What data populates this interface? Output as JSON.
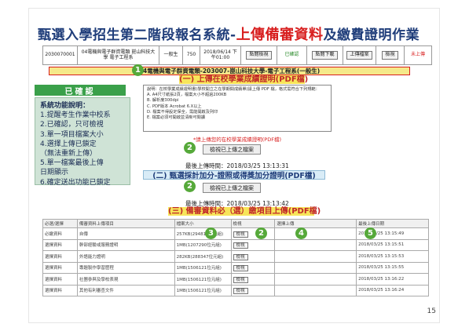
{
  "title": {
    "prefix": "甄選入學招生第二階段報名系統-",
    "highlight": "上傳備審資料",
    "suffix": "及繳費證明作業"
  },
  "record_row": {
    "code": "2030070001",
    "school": "04電機與電子群資電類 崑山科技大學 電子工程系",
    "group": "一般生",
    "fee": "750",
    "date": "2018/06/14 下午01:00",
    "btn1": "點閱檢視",
    "status": "已確認",
    "btn2": "點閱下載",
    "btn3": "上傳檔案",
    "btn4": "檢視",
    "unpaid": "未上傳"
  },
  "bubbles": [
    "1",
    "2",
    "2",
    "3",
    "2",
    "4",
    "5"
  ],
  "dept_bar": "04電機與電子群資電類-203007-崑山科技大學-電子工程系(一般生)",
  "section1": "(一) 上傳在校學業成績證明(PDF檔)",
  "confirmed_label": "已確認",
  "features": {
    "title": "系統功能說明：",
    "items": [
      "1.提醒考生作業中校系",
      "2.已確認，只可檢視",
      "3.單一項目檔案大小",
      "4.選擇上傳已鎖定",
      "（無法重新上傳）",
      "5.單一檔案最後上傳",
      "  日期顯示",
      "6.確定送出功能已鎖定"
    ]
  },
  "desc": {
    "lines": [
      "說明：在校學業成績證明書(學校開立之在學期間成績單)請上傳 PDF 檔，格式需符合下列規範：",
      "A. A4尺寸紙張2頁，檔案大小不超過200KB",
      "B. 解析度300dpi",
      "C. PDF版本 Acrobat 6.X以上",
      "D. 檔案不得設定保全，需能開啟及列印",
      "E. 檔案必須可開啟並清晰可閱讀"
    ]
  },
  "note_red": "*請上傳您的在校學業成績證明(PDF檔)",
  "upload_btn": "檢視已上傳之檔案",
  "time1": "最後上傳時間：2018/03/25 13:13:31",
  "section2": "(二) 甄選採計加分-證照或得獎加分證明(PDF檔)",
  "time2": "最後上傳時間：2018/03/25 13:13:42",
  "section3": "(三) 備審資料必（選）繳項目上傳(PDF檔)",
  "table": {
    "headers": [
      "必選/選擇",
      "備審資料上傳項目",
      "檔案大小",
      "檢視",
      "選擇上傳",
      "最後上傳日期"
    ],
    "rows": [
      [
        "必繳資料",
        "自傳",
        "257KB(294818位元組)",
        "檢視",
        "",
        "2018/03/25 13:15:49"
      ],
      [
        "選擇資料",
        "幹部經驗或服務證明",
        "1MB(1207290位元組)",
        "檢視",
        "",
        "2018/03/25 13:15:51"
      ],
      [
        "選擇資料",
        "外語能力證明",
        "282KB(288347位元組)",
        "檢視",
        "",
        "2018/03/25 13:15:53"
      ],
      [
        "選擇資料",
        "專題製作學習歷程",
        "1MB(1506121位元組)",
        "檢視",
        "",
        "2018/03/25 13:15:55"
      ],
      [
        "選擇資料",
        "社團參與及學校表現",
        "1MB(1506121位元組)",
        "檢視",
        "",
        "2018/03/25 13:16:22"
      ],
      [
        "選擇資料",
        "其他有利審查文件",
        "1MB(1506121位元組)",
        "檢視",
        "",
        "2018/03/25 13:16:24"
      ]
    ]
  },
  "page_number": "15"
}
